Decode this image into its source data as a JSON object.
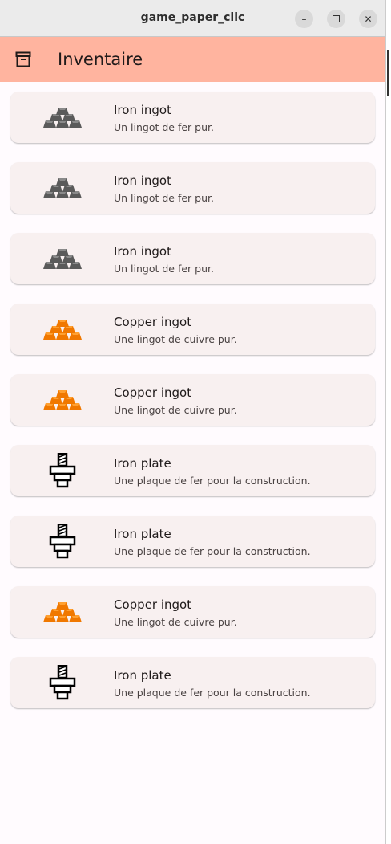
{
  "window": {
    "title": "game_paper_clic"
  },
  "appbar": {
    "title": "Inventaire",
    "icon": "archive-icon",
    "color": "#ffb49f"
  },
  "items": [
    {
      "title": "Iron ingot",
      "description": "Un lingot de fer pur.",
      "icon": "iron-ingot"
    },
    {
      "title": "Iron ingot",
      "description": "Un lingot de fer pur.",
      "icon": "iron-ingot"
    },
    {
      "title": "Iron ingot",
      "description": "Un lingot de fer pur.",
      "icon": "iron-ingot"
    },
    {
      "title": "Copper ingot",
      "description": "Une lingot de cuivre pur.",
      "icon": "copper-ingot"
    },
    {
      "title": "Copper ingot",
      "description": "Une lingot de cuivre pur.",
      "icon": "copper-ingot"
    },
    {
      "title": "Iron plate",
      "description": "Une plaque de fer pour la construction.",
      "icon": "iron-plate"
    },
    {
      "title": "Iron plate",
      "description": "Une plaque de fer pour la construction.",
      "icon": "iron-plate"
    },
    {
      "title": "Copper ingot",
      "description": "Une lingot de cuivre pur.",
      "icon": "copper-ingot"
    },
    {
      "title": "Iron plate",
      "description": "Une plaque de fer pour la construction.",
      "icon": "iron-plate"
    }
  ]
}
